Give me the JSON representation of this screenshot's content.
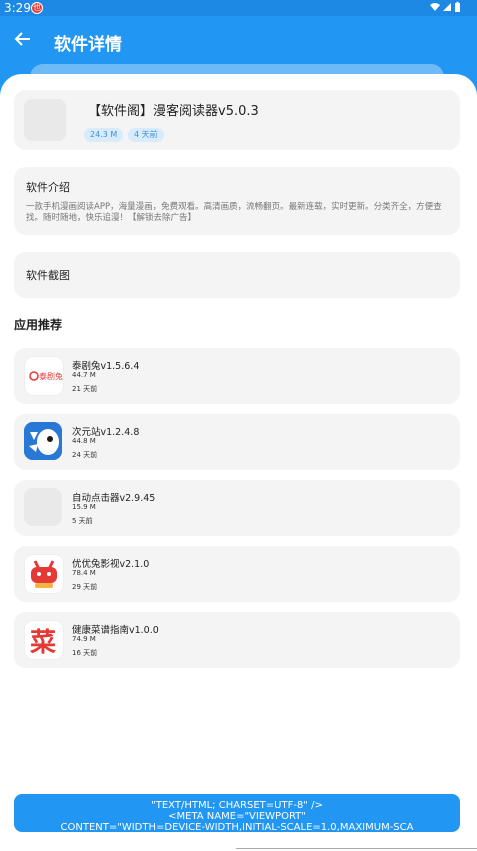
{
  "status_bar": {
    "time": "3:29",
    "notif_glyph": "也",
    "system_icons": "wifi-icon signal-icon battery-icon"
  },
  "header": {
    "title": "软件详情"
  },
  "app": {
    "name": "【软件阁】漫客阅读器v5.0.3",
    "size": "24.3 M",
    "updated": "4 天前"
  },
  "intro": {
    "heading": "软件介绍",
    "body": "一款手机漫画阅读APP，海量漫画，免费观看。高清画质，流畅翻页。最新连载，实时更新。分类齐全，方便查找。随时随地，快乐追漫！【解锁去除广告】"
  },
  "screenshots": {
    "heading": "软件截图"
  },
  "recommend": {
    "heading": "应用推荐",
    "items": [
      {
        "name": "泰剧兔v1.5.6.4",
        "size": "44.7 M",
        "time": "21 天前",
        "icon": "taiju-rabbit-icon",
        "icon_text": "泰剧兔"
      },
      {
        "name": "次元站v1.2.4.8",
        "size": "44.8 M",
        "time": "24 天前",
        "icon": "ciyuan-zhan-icon",
        "icon_text": ""
      },
      {
        "name": "自动点击器v2.9.45",
        "size": "15.9 M",
        "time": "5 天前",
        "icon": "placeholder-icon",
        "icon_text": ""
      },
      {
        "name": "优优兔影视v2.1.0",
        "size": "78.4 M",
        "time": "29 天前",
        "icon": "youyou-rabbit-icon",
        "icon_text": ""
      },
      {
        "name": "健康菜谱指南v1.0.0",
        "size": "74.9 M",
        "time": "16 天前",
        "icon": "recipe-icon",
        "icon_text": "菜"
      }
    ]
  },
  "download_button": {
    "lines": [
      "\"TEXT/HTML; CHARSET=UTF-8\" />",
      "<META NAME=\"VIEWPORT\"",
      "CONTENT=\"WIDTH=DEVICE-WIDTH,INITIAL-SCALE=1.0,MAXIMUM-SCA"
    ]
  },
  "colors": {
    "primary": "#2196f3",
    "tag_bg": "#d7ebfb",
    "tag_text": "#3f8fd8",
    "card_bg": "#f4f4f4"
  }
}
